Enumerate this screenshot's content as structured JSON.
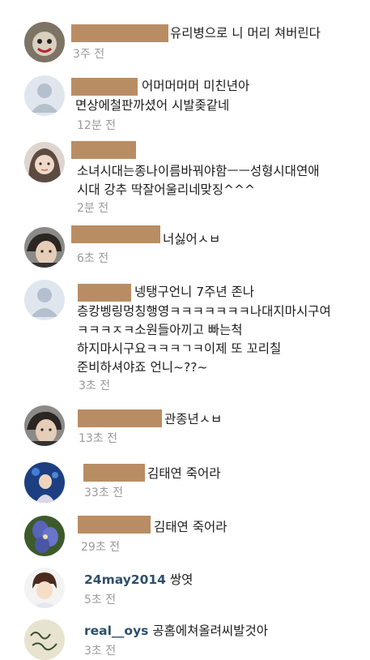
{
  "comments": [
    {
      "avatar": "cartoon-face-avatar",
      "lines": [
        "유리병으로 니 머리 쳐버린다"
      ],
      "time": "3주 전"
    },
    {
      "avatar": "default-person-avatar",
      "lines": [
        "어머머머머 미친년아",
        "면상에철판까셨어 시발좆같네"
      ],
      "time": "12분 전"
    },
    {
      "avatar": "girl-photo-avatar",
      "lines": [
        "소녀시대는종나이름바꿔야함ㅡㅡ성형시대연애",
        "시대 강추 딱잘어울리네맞징^^^"
      ],
      "time": "2분 전"
    },
    {
      "avatar": "boy-photo-avatar",
      "lines": [
        "너싫어ㅅㅂ"
      ],
      "time": "6초 전"
    },
    {
      "avatar": "default-person-avatar",
      "lines": [
        "넹탱구언니 7주년 존나",
        "층캉벵링멍칭행영ㅋㅋㅋㅋㅋㅋㅋ나대지마시구여",
        "ㅋㅋㅋㅈㅋ소원들아끼고 빠는척",
        "하지마시구요ㅋㅋㅋㄱㅋ이제 또 꼬리칠",
        "준비하셔야죠 언니~??~"
      ],
      "time": "3초 전"
    },
    {
      "avatar": "boy-photo-avatar",
      "lines": [
        "관종년ㅅㅂ"
      ],
      "time": "13초 전"
    },
    {
      "avatar": "concert-photo-avatar",
      "lines": [
        "김태연 죽어라"
      ],
      "time": "33초 전"
    },
    {
      "avatar": "flower-photo-avatar",
      "lines": [
        "김태연 죽어라"
      ],
      "time": "29초 전"
    },
    {
      "avatar": "anime-boy-avatar",
      "username": "24may2014",
      "lines": [
        "쌍엿"
      ],
      "time": "5초 전"
    },
    {
      "avatar": "handwriting-avatar",
      "username": "real__oys",
      "lines": [
        "공홈에쳐올려씨발것아"
      ],
      "time": "3초 전"
    }
  ]
}
